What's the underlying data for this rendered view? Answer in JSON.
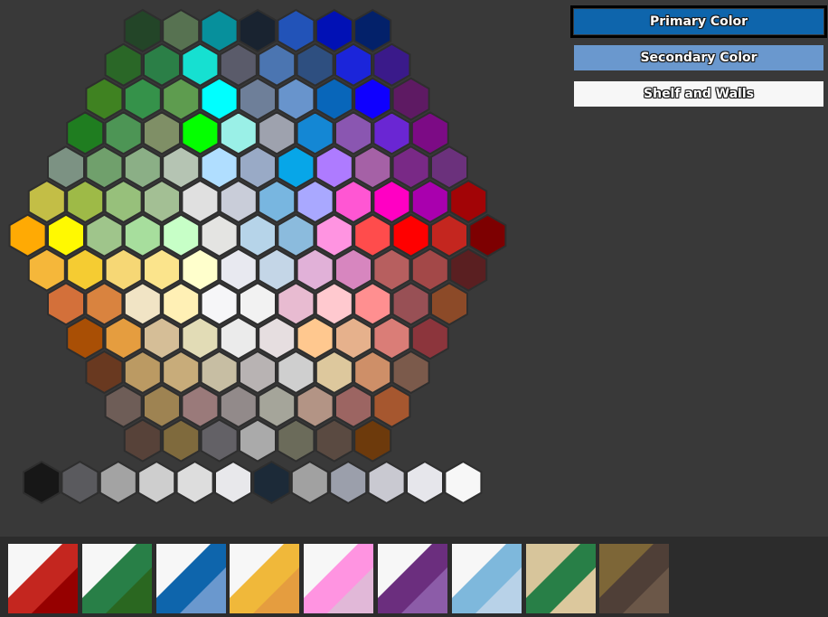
{
  "buttons": {
    "primary": {
      "label": "Primary Color",
      "color": "#0E65AC"
    },
    "secondary": {
      "label": "Secondary Color",
      "color": "#6A98CE"
    },
    "shelf": {
      "label": "Shelf and Walls",
      "color": "#F7F7F7"
    }
  },
  "palette_rows": [
    [
      "#234528",
      "#577251",
      "#07909C",
      "#192330",
      "#2253B8",
      "#0111B5",
      "#03216A"
    ],
    [
      "#2A6727",
      "#2B7F47",
      "#16E0D1",
      "#5A5B6A",
      "#4B75B1",
      "#2E4F80",
      "#1B25DA",
      "#3A1A8A"
    ],
    [
      "#3F8221",
      "#35924A",
      "#5E9C4F",
      "#00FFFF",
      "#6E7F99",
      "#6894CC",
      "#0866BA",
      "#0F00FF",
      "#5E1A63"
    ],
    [
      "#1F7D20",
      "#4D9555",
      "#7F8F66",
      "#04FF00",
      "#9AF0E7",
      "#9EA2AE",
      "#1487D4",
      "#8A56B1",
      "#6A26D3",
      "#7C0B85"
    ],
    [
      "#7C9283",
      "#70A06C",
      "#8BAF86",
      "#B5C4B3",
      "#B0DEFF",
      "#99AAC6",
      "#07A6E8",
      "#AE7BFF",
      "#A561A6",
      "#792986",
      "#6B317C"
    ],
    [
      "#C3BE46",
      "#9EBA47",
      "#97C07B",
      "#A3BF94",
      "#E0E0E0",
      "#C9CDD9",
      "#78B6E0",
      "#A9A8FF",
      "#FF56D3",
      "#FF00C3",
      "#A900AE",
      "#A20406"
    ],
    [
      "#FFAA04",
      "#FFF901",
      "#9FC58B",
      "#A7DE9D",
      "#C7FFC7",
      "#E4E4E2",
      "#B6D4E9",
      "#8BBBDD",
      "#FF94E1",
      "#FF4C4C",
      "#FF0000",
      "#C4261F",
      "#7D0001"
    ],
    [
      "#F5B73A",
      "#F5CC32",
      "#F6D775",
      "#FBE48C",
      "#FFFFCC",
      "#E8E9F0",
      "#C4D6E7",
      "#E1B1D8",
      "#D786BF",
      "#B75F5F",
      "#A34848",
      "#5A1F21"
    ],
    [
      "#D3703A",
      "#D9833F",
      "#F1E4C5",
      "#FFF0B5",
      "#F6F6F8",
      "#F2F2F2",
      "#E8BBD1",
      "#FFC9CF",
      "#FF8F90",
      "#985055",
      "#8C4A28"
    ],
    [
      "#A94F05",
      "#E59D3F",
      "#D5BE97",
      "#E2DCB6",
      "#EBEBEB",
      "#E6DEE0",
      "#FFC88F",
      "#E6B18C",
      "#DA7D77",
      "#8C353C"
    ],
    [
      "#693920",
      "#BB9A63",
      "#C8AC7A",
      "#C7BEA3",
      "#B8B3B3",
      "#CFCFCF",
      "#DDC89D",
      "#CE8F68",
      "#7B5A4B"
    ],
    [
      "#6E5D57",
      "#9E8352",
      "#9A7A7A",
      "#928A8A",
      "#A5A59A",
      "#B39485",
      "#9C6562",
      "#A6572F"
    ],
    [
      "#574239",
      "#7F6A3D",
      "#636166",
      "#AAAAAA",
      "#6B6B5A",
      "#5A4A41",
      "#6D3A0C"
    ]
  ],
  "gray_row": [
    "#171717",
    "#5A5A5E",
    "#A3A3A3",
    "#CECECE",
    "#DDDDDD",
    "#E8E8EB",
    "#1C2A38",
    "#A1A1A1",
    "#9B9FAB",
    "#C9C9D1",
    "#E6E6EB",
    "#F7F7F7"
  ],
  "presets": [
    {
      "name": "red",
      "c1": "#F7F7F7",
      "c2": "#C4261F",
      "c3": "#960000"
    },
    {
      "name": "green",
      "c1": "#F7F7F7",
      "c2": "#287F47",
      "c3": "#2A6720"
    },
    {
      "name": "blue",
      "c1": "#F7F7F7",
      "c2": "#0E65AC",
      "c3": "#6A98CE"
    },
    {
      "name": "yellow",
      "c1": "#F7F7F7",
      "c2": "#F0B83A",
      "c3": "#E59D3F"
    },
    {
      "name": "pink",
      "c1": "#F7F7F7",
      "c2": "#FF94E1",
      "c3": "#E1B8D8"
    },
    {
      "name": "purple",
      "c1": "#F7F7F7",
      "c2": "#6B2E7E",
      "c3": "#8C5CA8"
    },
    {
      "name": "light-blue",
      "c1": "#F7F7F7",
      "c2": "#7EB8DC",
      "c3": "#B8D2E8"
    },
    {
      "name": "tan-green",
      "c1": "#D7C59B",
      "c2": "#287F47",
      "c3": "#DCC89D"
    },
    {
      "name": "brown",
      "c1": "#7D6637",
      "c2": "#4F3F37",
      "c3": "#6B5748"
    }
  ]
}
